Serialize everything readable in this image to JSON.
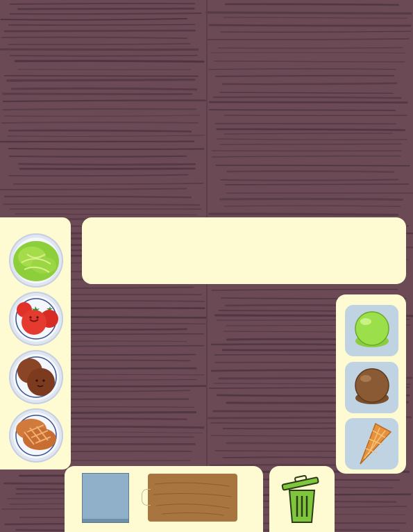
{
  "game": {
    "ingredients": [
      {
        "name": "lettuce-icon"
      },
      {
        "name": "tomato-icon"
      },
      {
        "name": "meat-patty-icon"
      },
      {
        "name": "bread-bun-icon"
      }
    ],
    "ice_cream": [
      {
        "name": "green-ice-cream-scoop-icon",
        "color": "#9be04a"
      },
      {
        "name": "chocolate-ice-cream-scoop-icon",
        "color": "#8a5a34"
      },
      {
        "name": "waffle-cone-icon",
        "color": "#e8913d"
      }
    ],
    "workspace": {
      "plate_color": "#8fb0c8",
      "board_color": "#a8743f"
    },
    "trash": {
      "name": "trash-can-icon",
      "color": "#7ec63b"
    },
    "colors": {
      "wood_background": "#6b4a56",
      "panel": "#fefbd3"
    }
  }
}
